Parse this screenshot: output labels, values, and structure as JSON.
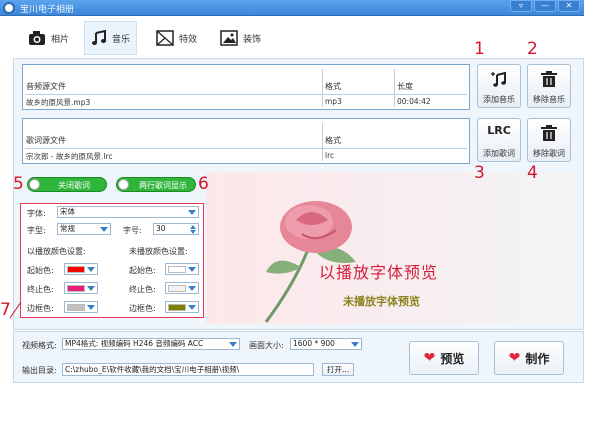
{
  "window": {
    "title": "宝川电子相册",
    "btn_down": "▿",
    "btn_min": "—",
    "btn_close": "✕"
  },
  "tabs": [
    {
      "label": "相片",
      "active": false
    },
    {
      "label": "音乐",
      "active": true
    },
    {
      "label": "特效",
      "active": false
    },
    {
      "label": "装饰",
      "active": false
    }
  ],
  "music_table": {
    "headers": [
      "音频源文件",
      "格式",
      "长度"
    ],
    "row": [
      "故乡的原风景.mp3",
      "mp3",
      "00:04:42"
    ]
  },
  "lyrics_table": {
    "headers": [
      "歌词源文件",
      "格式"
    ],
    "row": [
      "宗次郎 - 故乡的原风景.lrc",
      "lrc"
    ]
  },
  "buttons": {
    "add_music": "添加音乐",
    "remove_music": "移除音乐",
    "add_lyrics": "添加歌词",
    "remove_lyrics": "移除歌词",
    "lrc_icon_text": "LRC"
  },
  "toggles": {
    "close_lyrics": "关闭歌词",
    "two_line": "两行歌词显示"
  },
  "annotations": [
    "1",
    "2",
    "3",
    "4",
    "5",
    "6",
    "7"
  ],
  "font_panel": {
    "font_label": "字体:",
    "font_value": "宋体",
    "style_label": "字型:",
    "style_value": "常规",
    "size_label": "字号:",
    "size_value": "30",
    "played_title": "以播放颜色设置:",
    "unplayed_title": "未播放颜色设置:",
    "start_label": "起始色:",
    "end_label": "终止色:",
    "border_label": "边框色:",
    "played_colors": {
      "start": "#ff0000",
      "end": "#e8207a",
      "border": "#c0c0c0"
    },
    "unplayed_colors": {
      "start": "#ffffff",
      "end": "#f2f2f2",
      "border": "#808000"
    }
  },
  "preview": {
    "played_text": "以播放字体预览",
    "unplayed_text": "未播放字体预览"
  },
  "output": {
    "format_label": "视频格式:",
    "format_value": "MP4格式: 视频编码 H246 音频编码 ACC",
    "size_label": "画面大小:",
    "size_value": "1600 * 900",
    "dir_label": "输出目录:",
    "dir_value": "C:\\zhubo_E\\软件收藏\\我的文档\\宝川电子相册\\视频\\",
    "open_button": "打开...",
    "preview_button": "预览",
    "make_button": "制作"
  }
}
